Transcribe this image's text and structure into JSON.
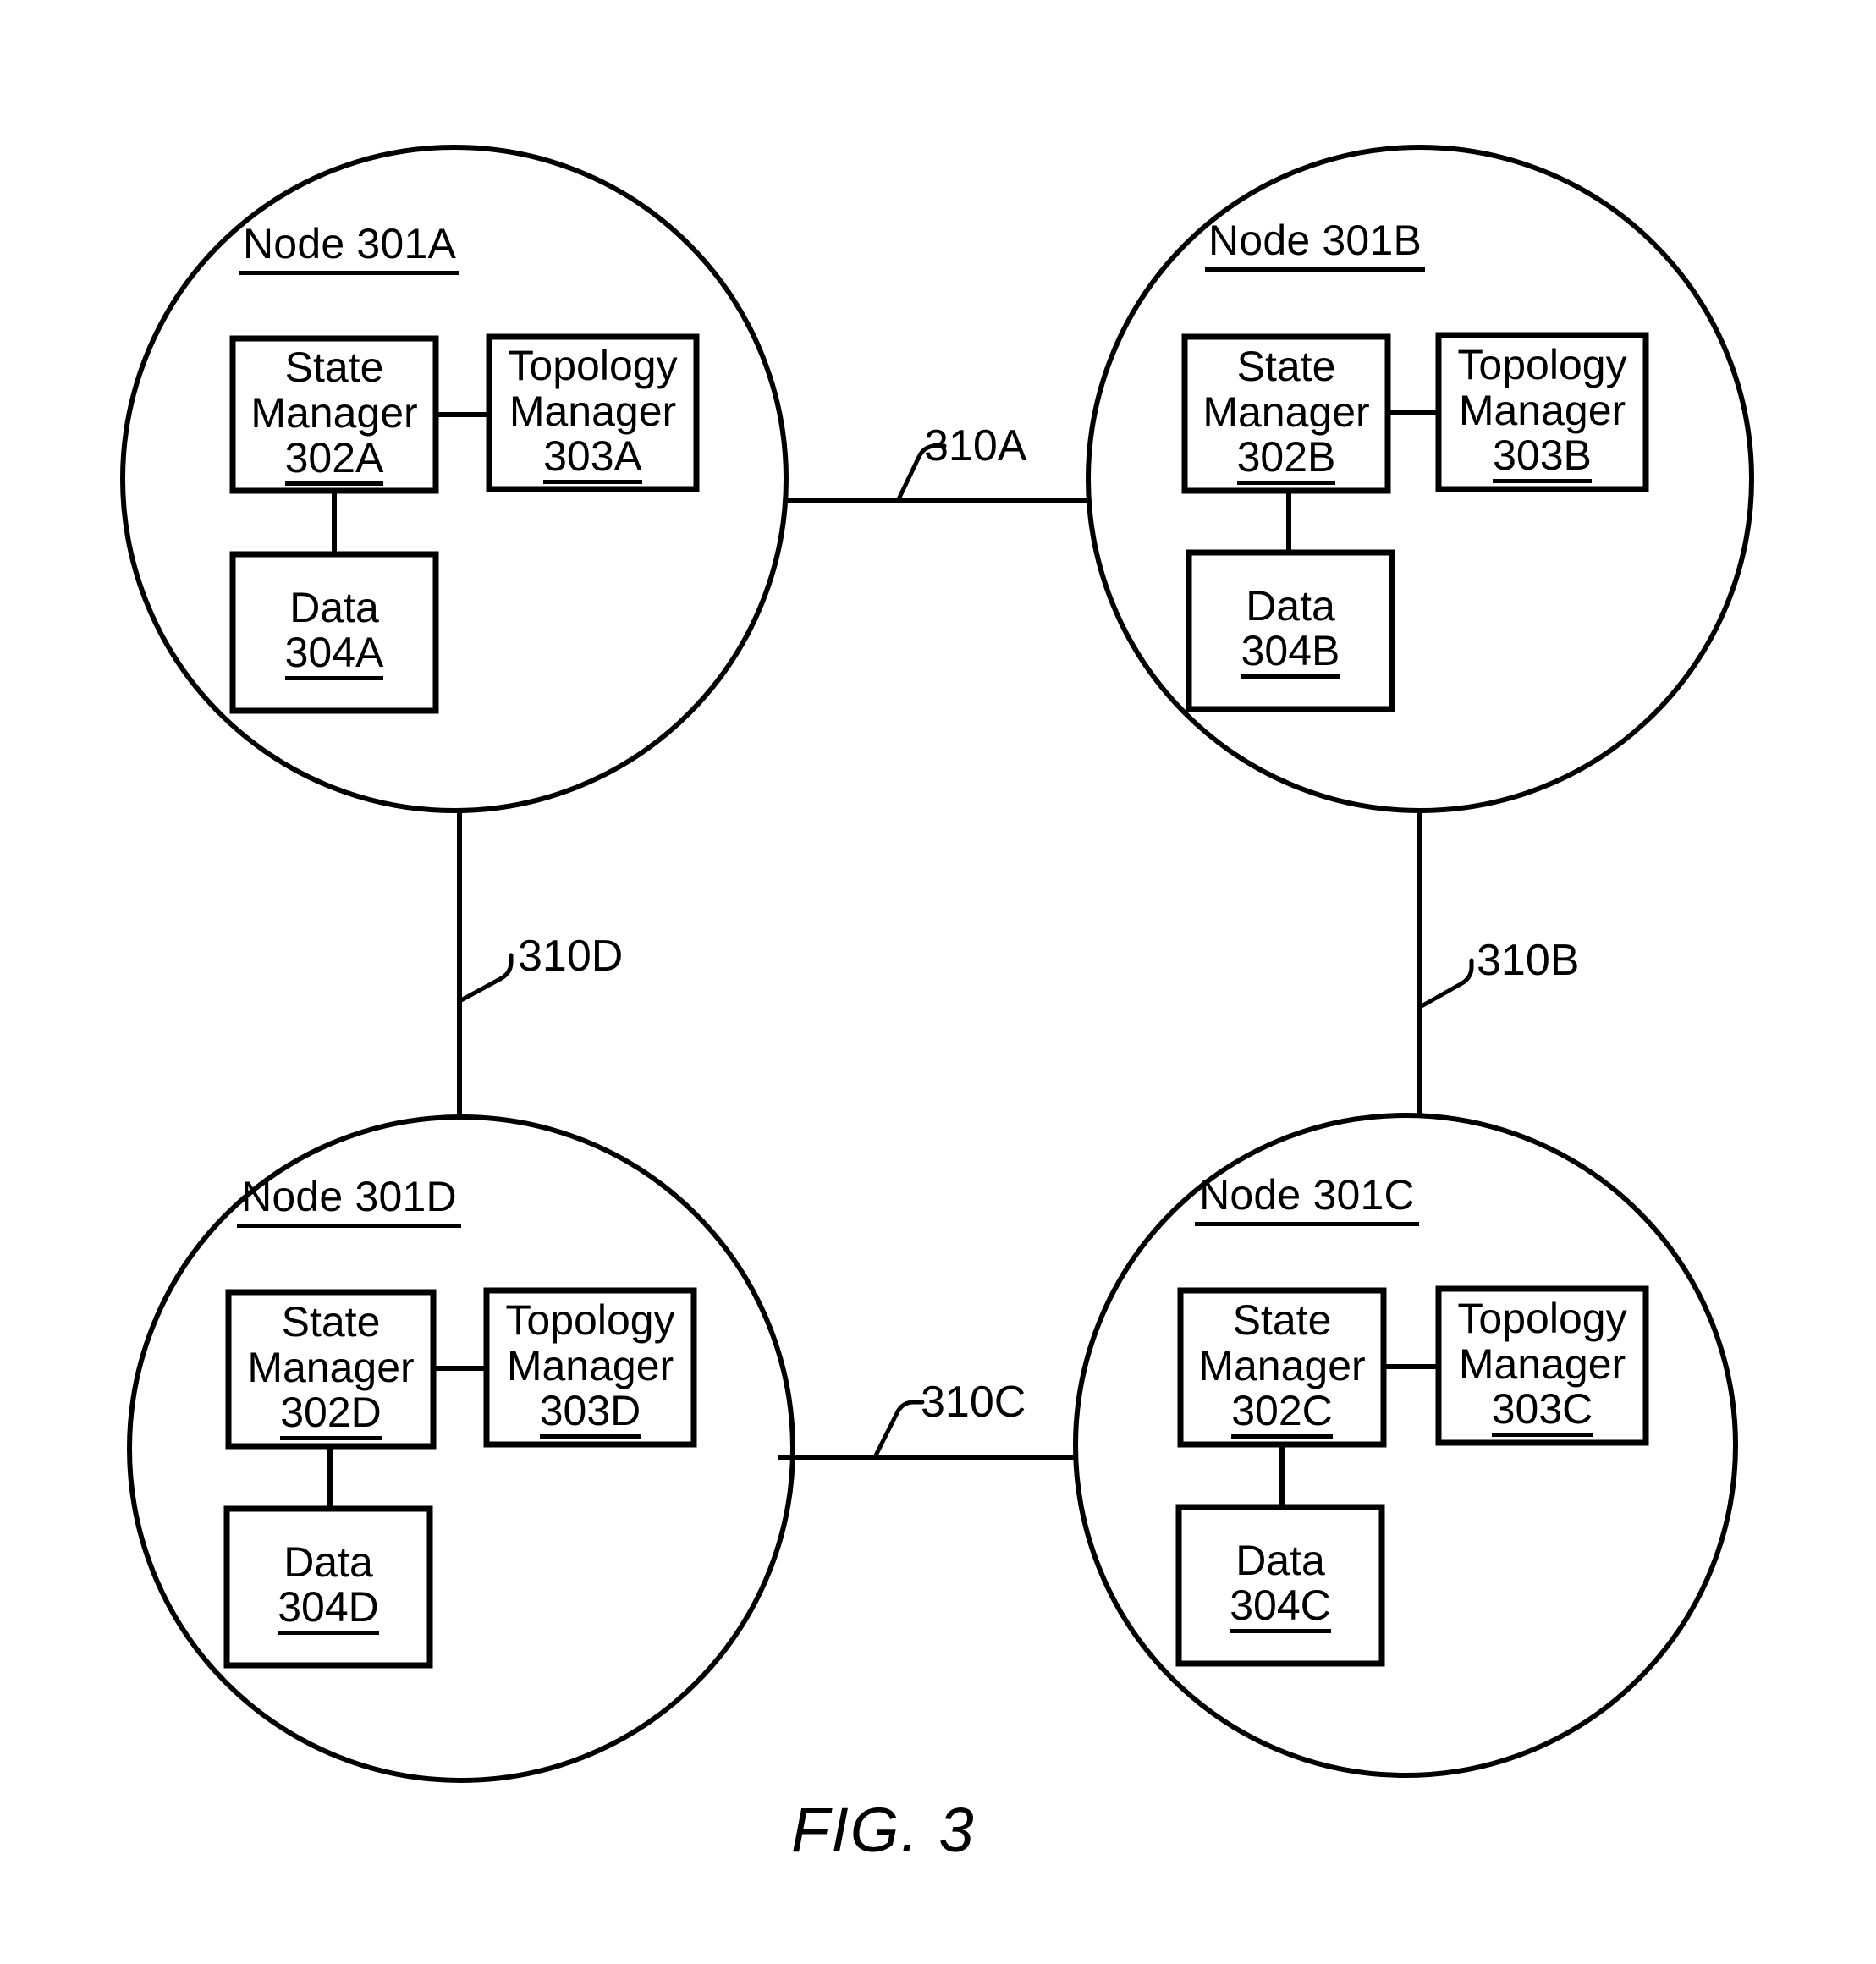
{
  "figure": {
    "caption": "FIG. 3",
    "stroke_color": "#000000",
    "background_color": "#ffffff"
  },
  "nodes": [
    {
      "id": "node-a",
      "title": "Node 301A",
      "state_manager": {
        "line1": "State",
        "line2": "Manager",
        "ref": "302A"
      },
      "topology_manager": {
        "line1": "Topology",
        "line2": "Manager",
        "ref": "303A"
      },
      "data": {
        "line1": "Data",
        "ref": "304A"
      }
    },
    {
      "id": "node-b",
      "title": "Node 301B",
      "state_manager": {
        "line1": "State",
        "line2": "Manager",
        "ref": "302B"
      },
      "topology_manager": {
        "line1": "Topology",
        "line2": "Manager",
        "ref": "303B"
      },
      "data": {
        "line1": "Data",
        "ref": "304B"
      }
    },
    {
      "id": "node-c",
      "title": "Node 301C",
      "state_manager": {
        "line1": "State",
        "line2": "Manager",
        "ref": "302C"
      },
      "topology_manager": {
        "line1": "Topology",
        "line2": "Manager",
        "ref": "303C"
      },
      "data": {
        "line1": "Data",
        "ref": "304C"
      }
    },
    {
      "id": "node-d",
      "title": "Node 301D",
      "state_manager": {
        "line1": "State",
        "line2": "Manager",
        "ref": "302D"
      },
      "topology_manager": {
        "line1": "Topology",
        "line2": "Manager",
        "ref": "303D"
      },
      "data": {
        "line1": "Data",
        "ref": "304D"
      }
    }
  ],
  "links": [
    {
      "id": "link-310a",
      "label": "310A",
      "from": "node-a",
      "to": "node-b"
    },
    {
      "id": "link-310b",
      "label": "310B",
      "from": "node-b",
      "to": "node-c"
    },
    {
      "id": "link-310c",
      "label": "310C",
      "from": "node-c",
      "to": "node-d"
    },
    {
      "id": "link-310d",
      "label": "310D",
      "from": "node-d",
      "to": "node-a"
    }
  ]
}
